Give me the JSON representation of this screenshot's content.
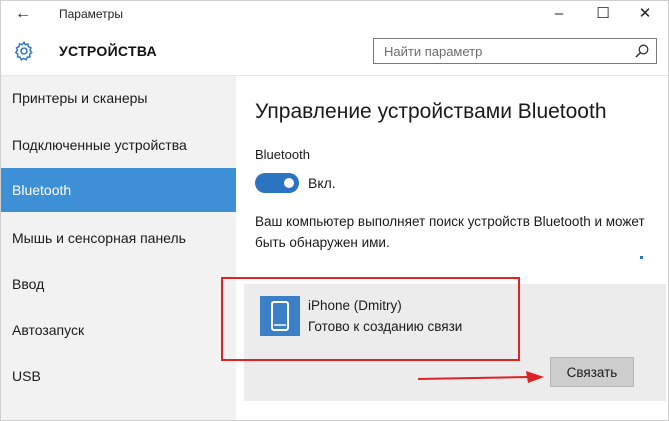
{
  "window": {
    "title": "Параметры"
  },
  "header": {
    "title": "УСТРОЙСТВА",
    "search_placeholder": "Найти параметр"
  },
  "sidebar": {
    "items": [
      {
        "label": "Принтеры и сканеры"
      },
      {
        "label": "Подключенные устройства"
      },
      {
        "label": "Bluetooth",
        "selected": true
      },
      {
        "label": "Мышь и сенсорная панель"
      },
      {
        "label": "Ввод"
      },
      {
        "label": "Автозапуск"
      },
      {
        "label": "USB"
      }
    ]
  },
  "content": {
    "title": "Управление устройствами Bluetooth",
    "bluetooth_label": "Bluetooth",
    "toggle": {
      "state_label": "Вкл.",
      "on": true
    },
    "description": "Ваш компьютер выполняет поиск устройств Bluetooth и может быть обнаружен ими.",
    "device": {
      "name": "iPhone (Dmitry)",
      "status": "Готово к созданию связи"
    },
    "connect_button": "Связать"
  },
  "colors": {
    "accent": "#3d8fd6",
    "toggle_on": "#2a74c2",
    "annotation_red": "#dd2323"
  },
  "icons": [
    "back-arrow-icon",
    "minimize-icon",
    "maximize-icon",
    "close-icon",
    "gear-icon",
    "search-icon",
    "phone-icon"
  ]
}
